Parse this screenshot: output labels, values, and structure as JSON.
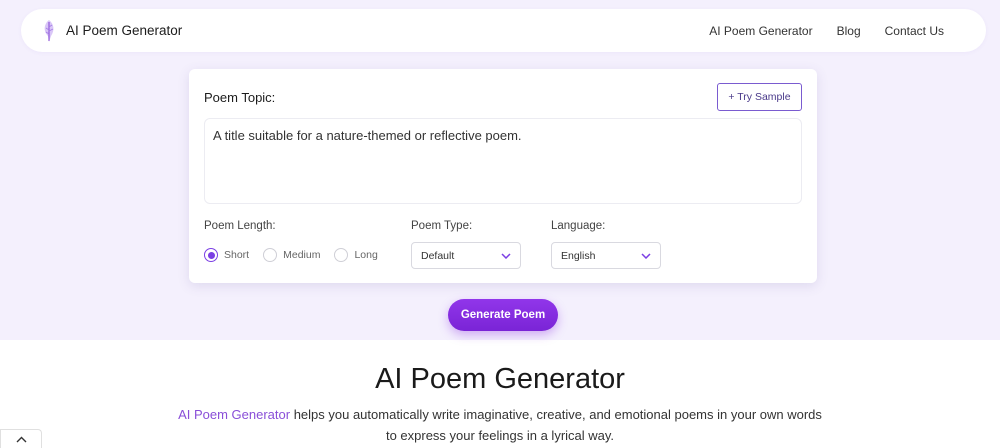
{
  "nav": {
    "brand": "AI Poem Generator",
    "links": [
      "AI Poem Generator",
      "Blog",
      "Contact Us"
    ]
  },
  "form": {
    "topic_label": "Poem Topic:",
    "try_sample": "+ Try Sample",
    "topic_value": "A title suitable for a nature-themed or reflective poem.",
    "length_label": "Poem Length:",
    "length_options": [
      "Short",
      "Medium",
      "Long"
    ],
    "length_selected": "Short",
    "type_label": "Poem Type:",
    "type_value": "Default",
    "language_label": "Language:",
    "language_value": "English"
  },
  "generate_button": "Generate Poem",
  "section": {
    "title": "AI Poem Generator",
    "description_link": "AI Poem Generator",
    "description_line1": " helps you automatically write imaginative, creative, and emotional poems in your own words",
    "description_line2": "to express your feelings in a lyrical way."
  },
  "colors": {
    "accent": "#8a2be2",
    "hero_bg": "#f4f0fd",
    "link": "#8a4fd8"
  },
  "icons": {
    "brand": "feather-logo-icon",
    "select": "chevron-down-icon",
    "scroll": "chevron-up-icon"
  }
}
